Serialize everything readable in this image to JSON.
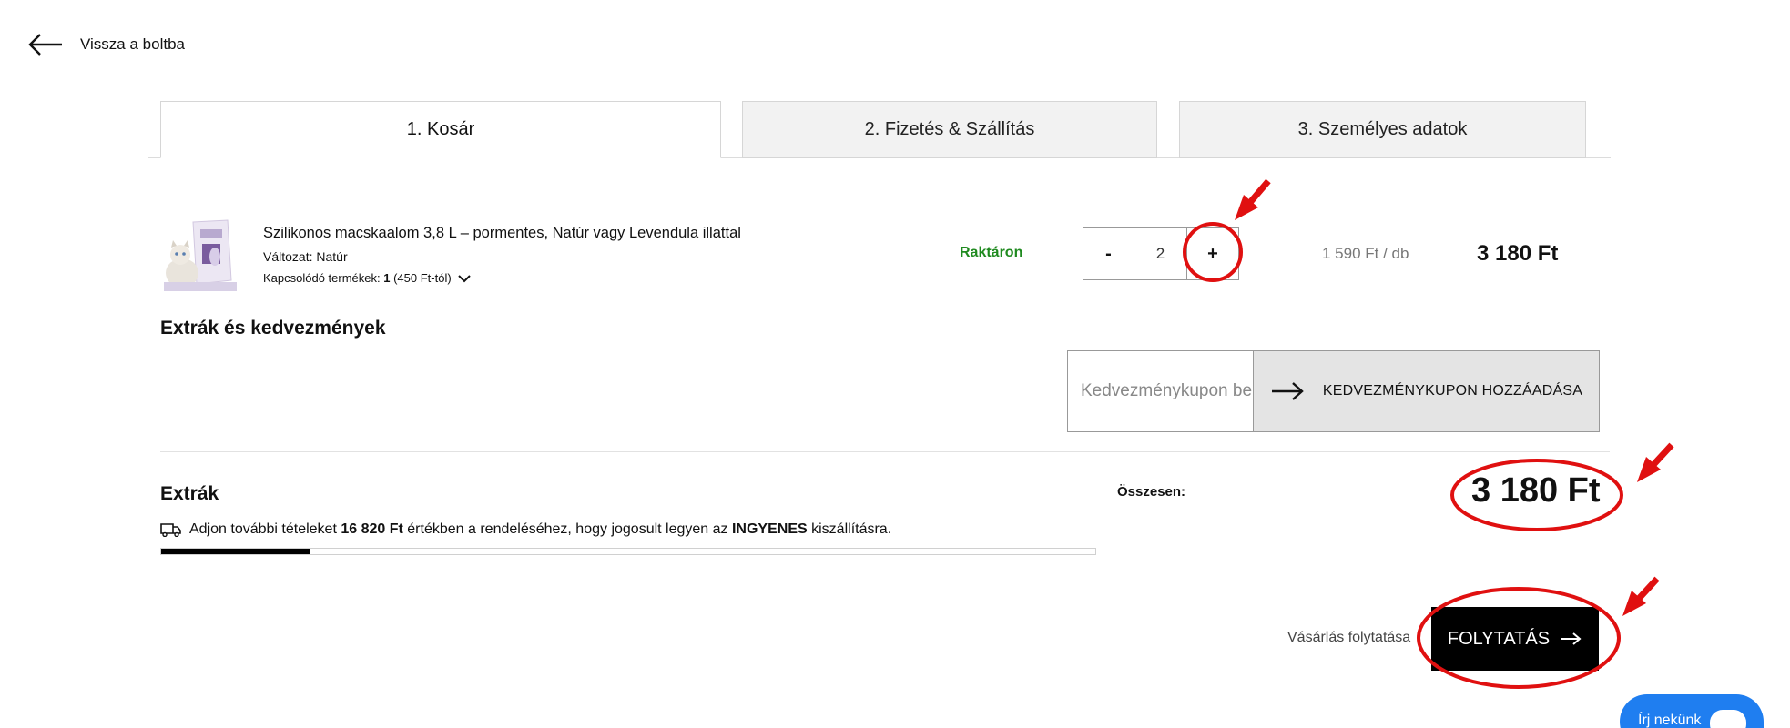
{
  "nav": {
    "back_label": "Vissza a boltba"
  },
  "tabs": [
    {
      "label": "1. Kosár",
      "active": true
    },
    {
      "label": "2. Fizetés & Szállítás",
      "active": false
    },
    {
      "label": "3. Személyes adatok",
      "active": false
    }
  ],
  "cart_item": {
    "name": "Szilikonos macskaalom 3,8 L – pormentes, Natúr vagy Levendula illattal",
    "variant": "Változat: Natúr",
    "related_prefix": "Kapcsolódó termékek: ",
    "related_count": "1",
    "related_suffix": "(450 Ft-tól)",
    "stock_status": "Raktáron",
    "quantity_minus": "-",
    "quantity": "2",
    "quantity_plus": "+",
    "unit_price": "1 590 Ft / db",
    "line_total": "3 180 Ft"
  },
  "discounts": {
    "title": "Extrák és kedvezmények",
    "coupon_placeholder": "Kedvezménykupon beírása",
    "coupon_button": "KEDVEZMÉNYKUPON HOZZÁADÁSA"
  },
  "extras": {
    "title": "Extrák",
    "shipping_pre": "Adjon további tételeket",
    "shipping_amount": "16 820 Ft",
    "shipping_mid": "értékben a rendeléséhez, hogy jogosult legyen az",
    "shipping_free": "INGYENES",
    "shipping_post": "kiszállításra.",
    "free_shipping_progress": 0.16
  },
  "summary": {
    "total_label": "Összesen:",
    "total_value": "3 180 Ft"
  },
  "actions": {
    "continue_shopping": "Vásárlás folytatása",
    "continue_button": "FOLYTATÁS"
  },
  "chat": {
    "label": "Írj nekünk"
  },
  "colors": {
    "stock_green": "#1f8a1f",
    "annotation_red": "#e01010",
    "chat_blue": "#1f7ef0"
  }
}
